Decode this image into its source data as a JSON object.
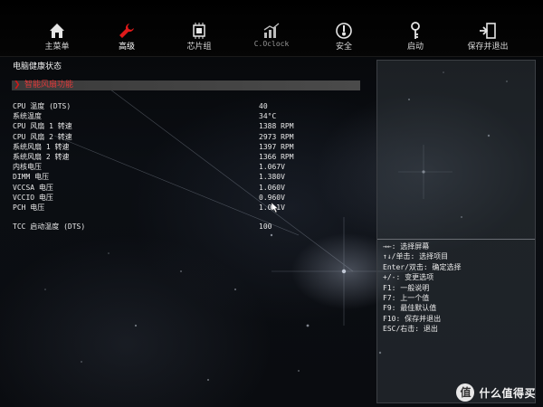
{
  "nav": {
    "tabs": [
      {
        "label": "主菜单",
        "icon": "home-icon",
        "active": false
      },
      {
        "label": "高级",
        "icon": "wrench-icon",
        "active": true
      },
      {
        "label": "芯片组",
        "icon": "chip-icon",
        "active": false
      },
      {
        "label": "C.Oclock",
        "icon": "chart-icon",
        "active": false
      },
      {
        "label": "安全",
        "icon": "shield-icon",
        "active": false
      },
      {
        "label": "启动",
        "icon": "key-icon",
        "active": false
      },
      {
        "label": "保存并退出",
        "icon": "exit-icon",
        "active": false
      }
    ]
  },
  "colors": {
    "accent": "#d01818",
    "highlight_text": "#e23a3a",
    "text": "#eaeaea"
  },
  "main": {
    "title": "电脑健康状态",
    "submenu_label": "智能风扇功能",
    "readings": [
      {
        "label": "CPU 温度 (DTS)",
        "value": "40"
      },
      {
        "label": "系统温度",
        "value": "34°C"
      },
      {
        "label": "CPU 风扇 1 转速",
        "value": "1388 RPM"
      },
      {
        "label": "CPU 风扇 2 转速",
        "value": "2973 RPM"
      },
      {
        "label": "系统风扇 1 转速",
        "value": "1397 RPM"
      },
      {
        "label": "系统风扇 2 转速",
        "value": "1366 RPM"
      },
      {
        "label": "内核电压",
        "value": "1.067V"
      },
      {
        "label": "DIMM 电压",
        "value": "1.380V"
      },
      {
        "label": "VCCSA 电压",
        "value": "1.060V"
      },
      {
        "label": "VCCIO 电压",
        "value": "0.960V"
      },
      {
        "label": "PCH 电压",
        "value": "1.0●1V"
      }
    ],
    "tcc": {
      "label": "TCC 启动温度 (DTS)",
      "value": "100"
    }
  },
  "help": {
    "lines": [
      "→←: 选择屏幕",
      "↑↓/单击: 选择项目",
      "Enter/双击: 确定选择",
      "+/-: 变更选项",
      "F1: 一般说明",
      "F7: 上一个值",
      "F9: 最佳默认值",
      "F10: 保存并退出",
      "ESC/右击: 退出"
    ]
  },
  "watermark": {
    "logo_char": "值",
    "text": "什么值得买"
  }
}
